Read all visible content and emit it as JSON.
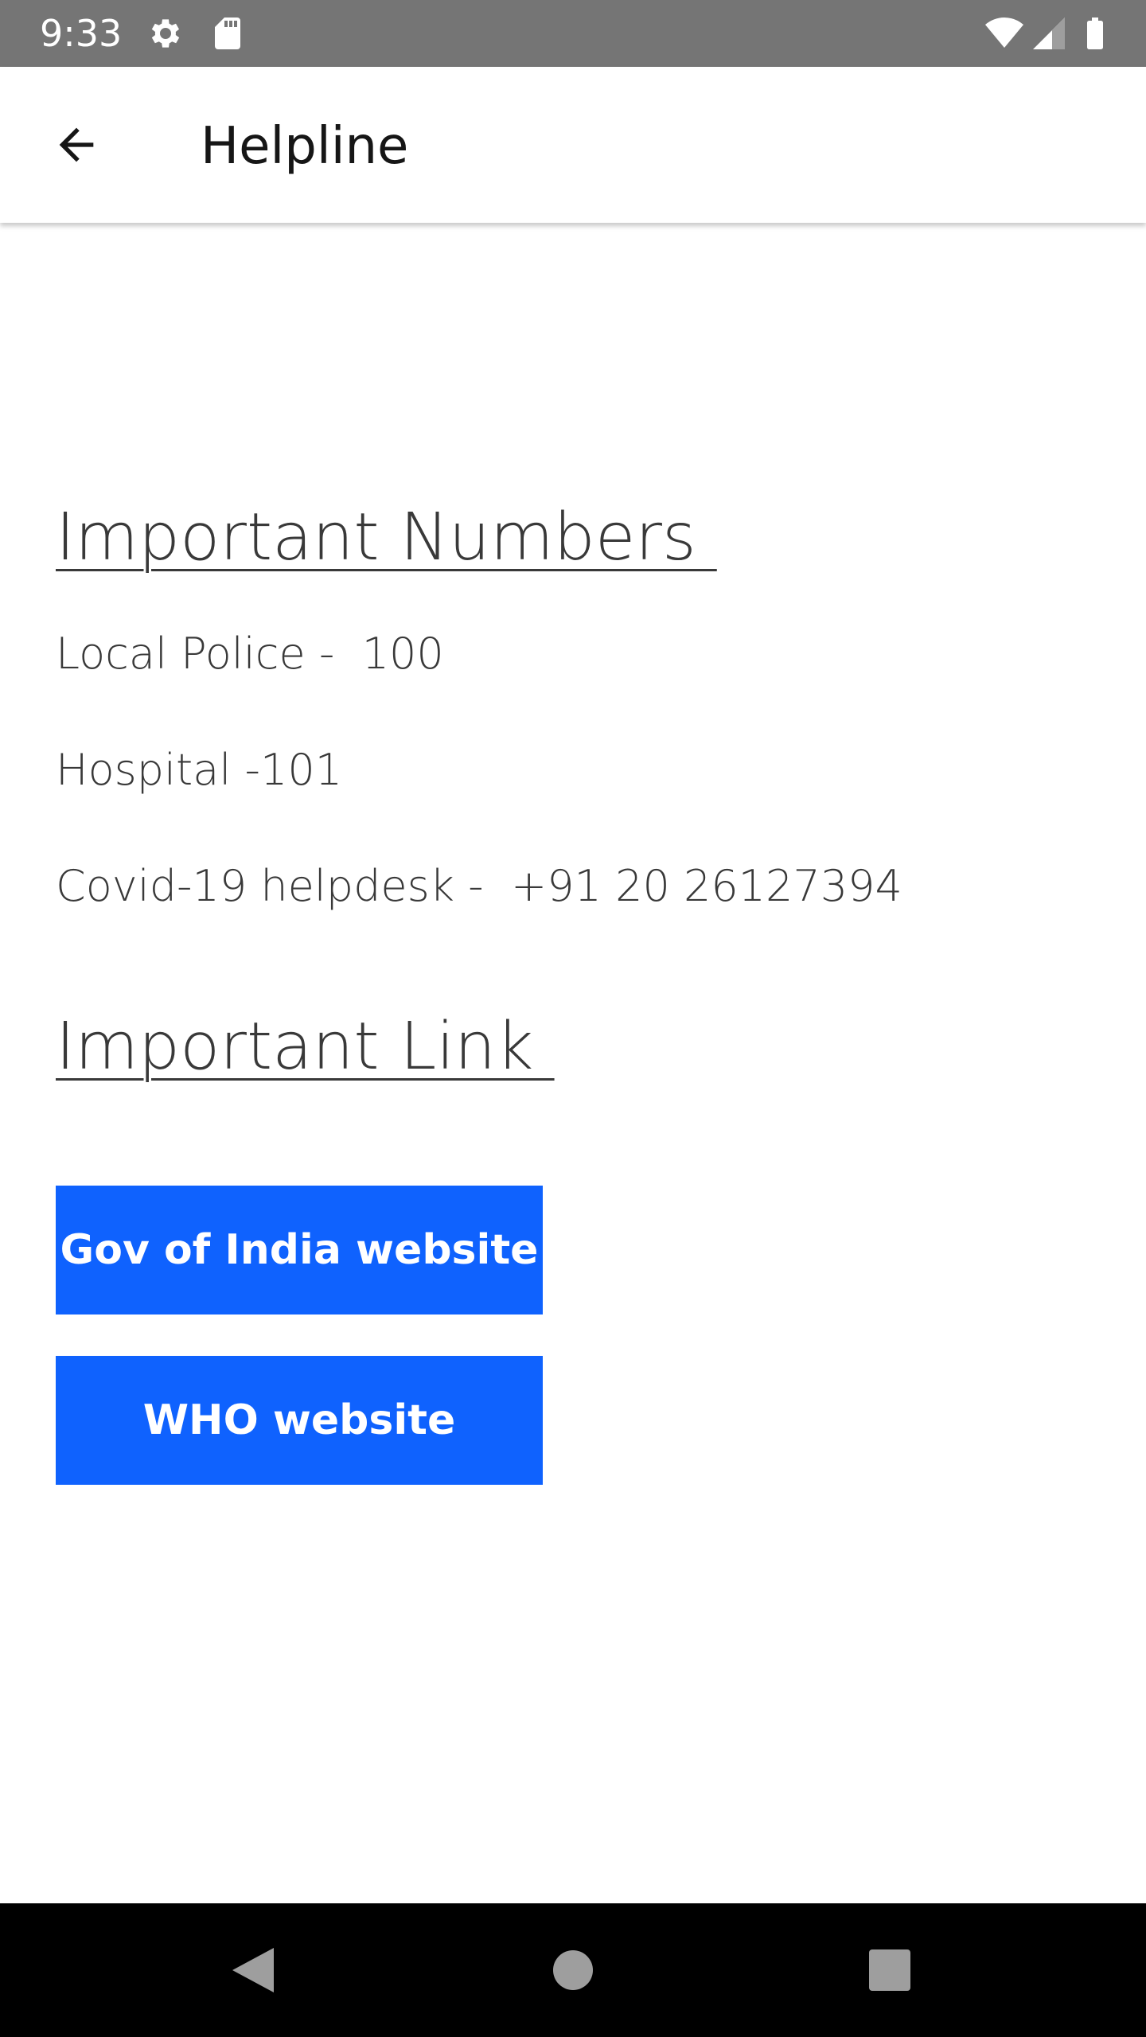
{
  "status_bar": {
    "time": "9:33",
    "icons": [
      "settings-gear-icon",
      "sd-card-icon",
      "wifi-icon",
      "cell-signal-icon",
      "battery-icon"
    ],
    "background": "#757575"
  },
  "app_bar": {
    "back_icon": "arrow-back-icon",
    "title": "Helpline"
  },
  "numbers_section": {
    "heading": "Important Numbers ",
    "items": [
      "Local Police -  100",
      "Hospital -101",
      "Covid-19 helpdesk -  +91 20 26127394"
    ]
  },
  "links_section": {
    "heading": "Important Link ",
    "buttons": [
      "Gov of India website",
      "WHO website"
    ],
    "button_color": "#0f62fe"
  },
  "nav_bar": {
    "icons": [
      "back-triangle-icon",
      "home-circle-icon",
      "recents-square-icon"
    ]
  }
}
